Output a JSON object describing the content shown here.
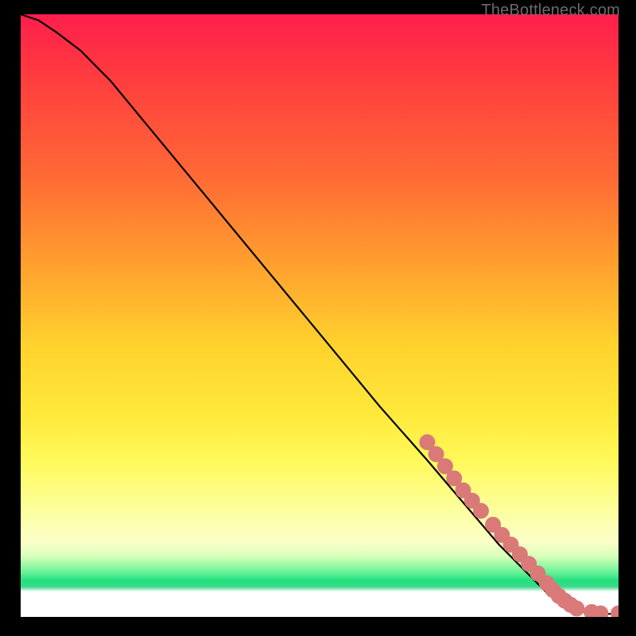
{
  "attribution": "TheBottleneck.com",
  "colors": {
    "dot": "#d97a78",
    "curve": "#000000"
  },
  "chart_data": {
    "type": "line",
    "title": "",
    "xlabel": "",
    "ylabel": "",
    "xlim": [
      0,
      100
    ],
    "ylim": [
      0,
      100
    ],
    "series": [
      {
        "name": "curve",
        "x": [
          0,
          3,
          6,
          10,
          15,
          20,
          30,
          40,
          50,
          60,
          68,
          74,
          80,
          85,
          88,
          91,
          93,
          96,
          100
        ],
        "y": [
          100,
          99,
          97,
          94,
          89,
          83,
          71,
          59,
          47,
          35,
          26,
          19,
          12,
          7,
          4,
          2,
          1,
          0.5,
          0.5
        ]
      }
    ],
    "points": [
      {
        "x": 68,
        "y": 29
      },
      {
        "x": 69.5,
        "y": 27
      },
      {
        "x": 71,
        "y": 25
      },
      {
        "x": 72.5,
        "y": 23
      },
      {
        "x": 74,
        "y": 21
      },
      {
        "x": 75.5,
        "y": 19.3
      },
      {
        "x": 77,
        "y": 17.6
      },
      {
        "x": 79,
        "y": 15.3
      },
      {
        "x": 80.5,
        "y": 13.6
      },
      {
        "x": 82,
        "y": 12
      },
      {
        "x": 83.5,
        "y": 10.4
      },
      {
        "x": 85,
        "y": 8.8
      },
      {
        "x": 86.5,
        "y": 7.2
      },
      {
        "x": 88,
        "y": 5.6
      },
      {
        "x": 89,
        "y": 4.5
      },
      {
        "x": 90,
        "y": 3.5
      },
      {
        "x": 91,
        "y": 2.7
      },
      {
        "x": 92,
        "y": 2.0
      },
      {
        "x": 93,
        "y": 1.4
      },
      {
        "x": 95.5,
        "y": 0.8
      },
      {
        "x": 97,
        "y": 0.6
      },
      {
        "x": 100,
        "y": 0.6
      }
    ]
  }
}
